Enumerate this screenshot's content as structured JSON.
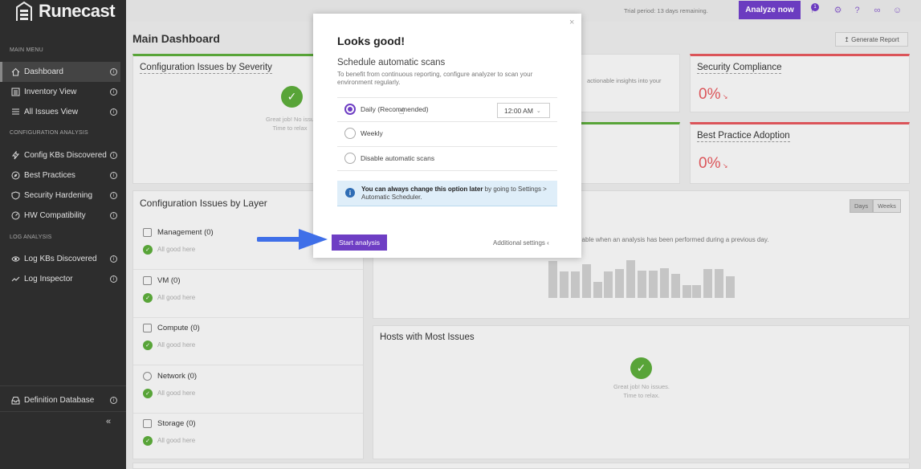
{
  "app": {
    "name": "Runecast"
  },
  "sidebar": {
    "main_menu_label": "MAIN MENU",
    "config_label": "CONFIGURATION ANALYSIS",
    "log_label": "LOG ANALYSIS",
    "items": [
      {
        "label": "Dashboard",
        "icon": "home-icon"
      },
      {
        "label": "Inventory View",
        "icon": "list-icon"
      },
      {
        "label": "All Issues View",
        "icon": "list-icon"
      },
      {
        "label": "Config KBs Discovered",
        "icon": "bolt-icon"
      },
      {
        "label": "Best Practices",
        "icon": "compass-icon"
      },
      {
        "label": "Security Hardening",
        "icon": "shield-icon"
      },
      {
        "label": "HW Compatibility",
        "icon": "gauge-icon"
      },
      {
        "label": "Log KBs Discovered",
        "icon": "eye-icon"
      },
      {
        "label": "Log Inspector",
        "icon": "trend-icon"
      },
      {
        "label": "Definition Database",
        "icon": "inbox-icon"
      }
    ],
    "collapse": "«"
  },
  "topbar": {
    "trial": "Trial period: 13 days remaining.",
    "analyze": "Analyze now",
    "notifications": "1"
  },
  "main": {
    "title": "Main Dashboard",
    "generate_report": "Generate Report",
    "severity_title": "Configuration Issues by Severity",
    "severity_msg1": "Great job! No issu",
    "severity_msg2": "Time to relax",
    "insights_text": "actionable insights into your",
    "security_title": "Security Compliance",
    "security_pct": "0%",
    "bp_title": "Best Practice Adoption",
    "bp_pct": "0%",
    "layer_title": "Configuration Issues by Layer",
    "layers": [
      {
        "name": "Management (0)",
        "status": "All good here"
      },
      {
        "name": "VM (0)",
        "status": "All good here"
      },
      {
        "name": "Compute (0)",
        "status": "All good here"
      },
      {
        "name": "Network (0)",
        "status": "All good here"
      },
      {
        "name": "Storage (0)",
        "status": "All good here"
      }
    ],
    "history_text": "ilable when an analysis has been performed during a previous day.",
    "days": "Days",
    "weeks": "Weeks",
    "hosts_title": "Hosts with Most Issues",
    "hosts_msg1": "Great job! No issues.",
    "hosts_msg2": "Time to relax."
  },
  "modal": {
    "close": "×",
    "title": "Looks good!",
    "subtitle": "Schedule automatic scans",
    "desc": "To benefit from continuous reporting, configure analyzer to scan your environment regularly.",
    "options": [
      {
        "label": "Daily (Recommended)",
        "selected": true
      },
      {
        "label": "Weekly",
        "selected": false
      },
      {
        "label": "Disable automatic scans",
        "selected": false
      }
    ],
    "time": "12:00 AM",
    "info_bold": "You can always change this option later",
    "info_rest": " by going to Settings > Automatic Scheduler.",
    "start": "Start analysis",
    "additional": "Additional settings ‹"
  }
}
